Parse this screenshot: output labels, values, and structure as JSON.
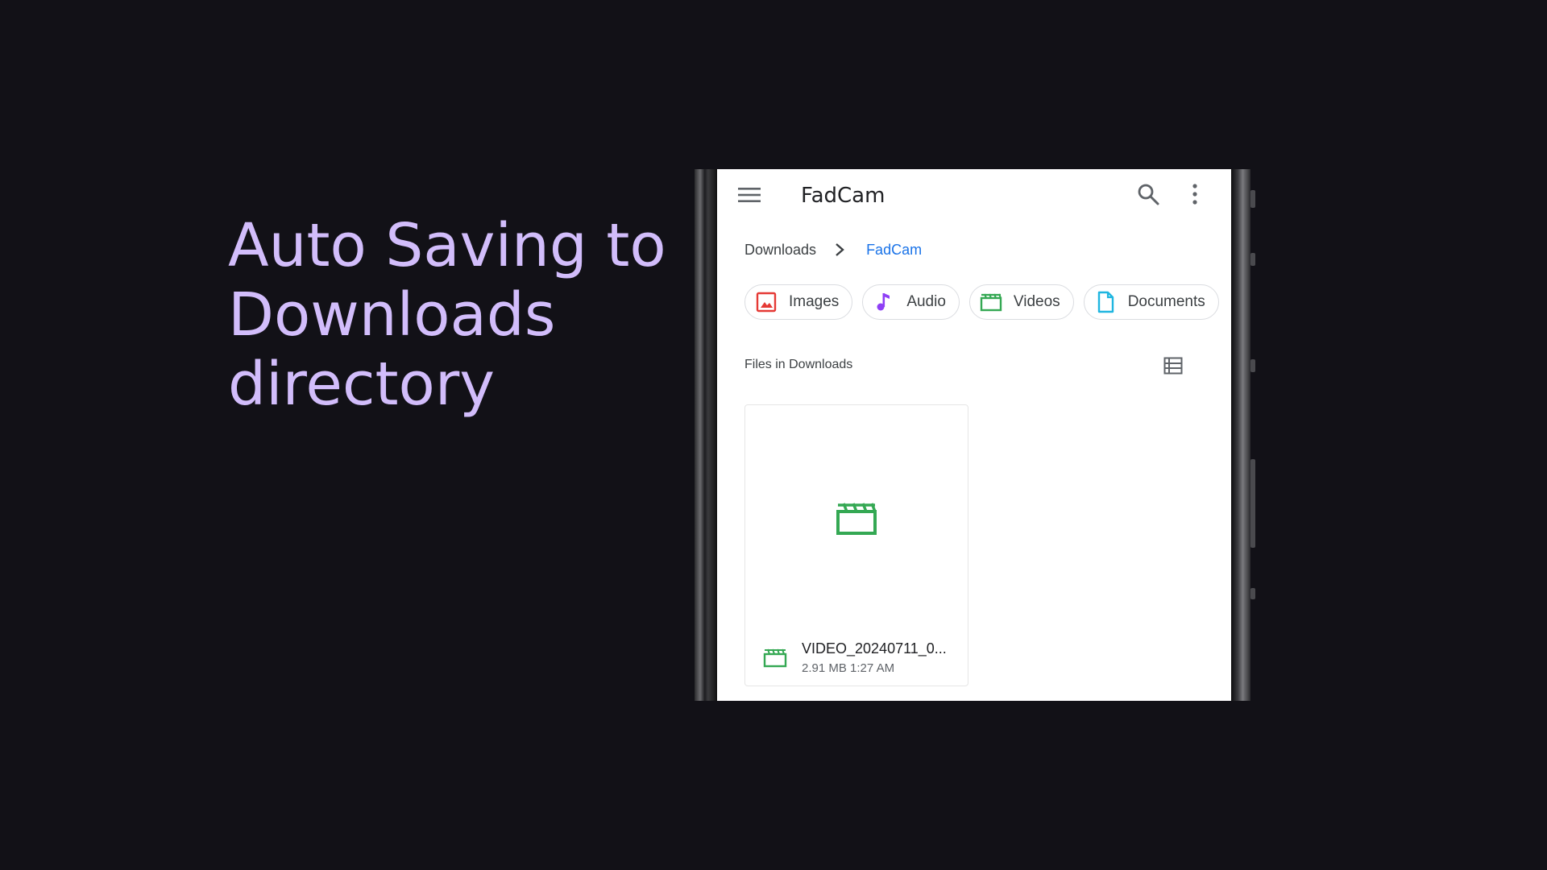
{
  "headline": {
    "lines": [
      "Auto Saving to",
      "Downloads",
      "directory"
    ]
  },
  "colors": {
    "background": "#121117",
    "headline": "#d2bdfb",
    "link_blue": "#1a73e8",
    "images_red": "#e53935",
    "audio_purple": "#8e3ff5",
    "videos_green": "#34a853",
    "documents_cyan": "#1fb6e0"
  },
  "app": {
    "title": "FadCam",
    "icons": [
      "menu-icon",
      "search-icon",
      "more-vert-icon"
    ]
  },
  "breadcrumb": {
    "root": "Downloads",
    "current": "FadCam"
  },
  "chips": [
    {
      "label": "Images",
      "icon": "image-icon"
    },
    {
      "label": "Audio",
      "icon": "music-note-icon"
    },
    {
      "label": "Videos",
      "icon": "movie-icon"
    },
    {
      "label": "Documents",
      "icon": "document-icon"
    }
  ],
  "files_section": {
    "label": "Files in Downloads",
    "view_toggle_icon": "list-view-icon"
  },
  "files": [
    {
      "name": "VIDEO_20240711_0...",
      "size": "2.91 MB",
      "time": "1:27 AM",
      "meta": "2.91 MB 1:27 AM",
      "icon": "movie-icon"
    }
  ]
}
